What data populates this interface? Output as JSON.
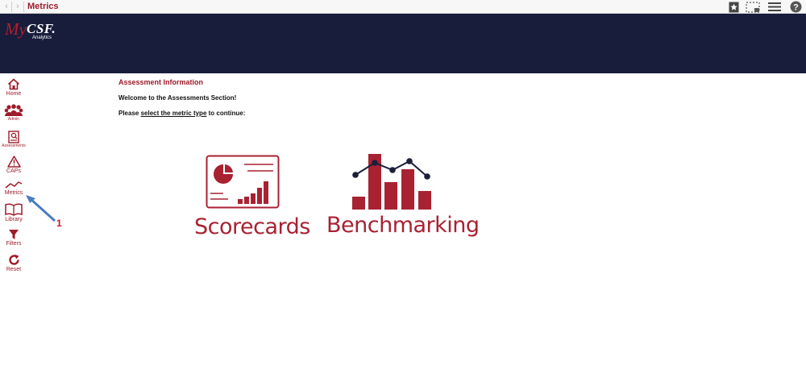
{
  "window": {
    "title": "Metrics",
    "back_glyph": "‹",
    "forward_glyph": "›"
  },
  "toolbar": {
    "icons": [
      "bookmark-star-icon",
      "screenshot-select-icon",
      "menu-icon",
      "help-icon"
    ]
  },
  "brand": {
    "logo_my": "My",
    "logo_csf": "CSF.",
    "logo_sub": "Analytics",
    "header_color": "#181d3c",
    "accent_color": "#9e1b2a"
  },
  "sidebar": {
    "items": [
      {
        "label": "Home",
        "icon": "home-icon"
      },
      {
        "label": "Admin",
        "icon": "people-group-icon"
      },
      {
        "label": "Assessments",
        "icon": "assessment-doc-icon"
      },
      {
        "label": "CAPs",
        "icon": "warning-icon"
      },
      {
        "label": "Metrics",
        "icon": "line-trend-icon"
      },
      {
        "label": "Library",
        "icon": "book-icon"
      },
      {
        "label": "Filters",
        "icon": "filter-icon"
      },
      {
        "label": "Reset",
        "icon": "refresh-icon"
      }
    ]
  },
  "main": {
    "section_title": "Assessment Information",
    "welcome": "Welcome to the Assessments Section!",
    "instruction_prefix": "Please ",
    "instruction_link": "select the metric type",
    "instruction_suffix": " to continue:",
    "cards": [
      {
        "label": "Scorecards",
        "icon": "scorecard-dashboard-icon"
      },
      {
        "label": "Benchmarking",
        "icon": "bar-line-chart-icon"
      }
    ]
  },
  "annotation": {
    "number": "1",
    "arrow_color": "#4a7cc0",
    "number_color": "#c8102e"
  }
}
